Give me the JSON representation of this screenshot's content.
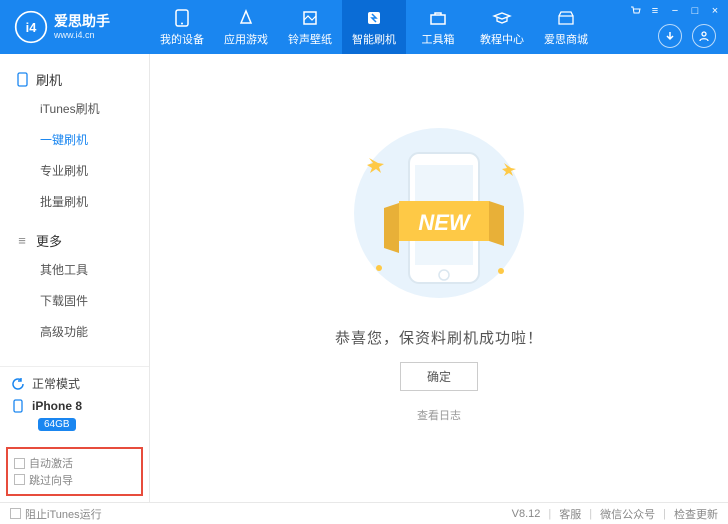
{
  "brand": {
    "name": "爱思助手",
    "sub": "www.i4.cn"
  },
  "nav": {
    "items": [
      {
        "label": "我的设备"
      },
      {
        "label": "应用游戏"
      },
      {
        "label": "铃声壁纸"
      },
      {
        "label": "智能刷机"
      },
      {
        "label": "工具箱"
      },
      {
        "label": "教程中心"
      },
      {
        "label": "爱思商城"
      }
    ],
    "activeIndex": 3
  },
  "sidebar": {
    "group1": {
      "title": "刷机",
      "items": [
        "iTunes刷机",
        "一键刷机",
        "专业刷机",
        "批量刷机"
      ],
      "selectedIndex": 1
    },
    "group2": {
      "title": "更多",
      "items": [
        "其他工具",
        "下载固件",
        "高级功能"
      ]
    },
    "mode": "正常模式",
    "device": {
      "name": "iPhone 8",
      "storage": "64GB"
    },
    "opts": {
      "autoActivate": "自动激活",
      "skipGuide": "跳过向导"
    }
  },
  "main": {
    "successText": "恭喜您，保资料刷机成功啦！",
    "okLabel": "确定",
    "logLabel": "查看日志",
    "newBadge": "NEW"
  },
  "footer": {
    "blockItunes": "阻止iTunes运行",
    "version": "V8.12",
    "support": "客服",
    "wechat": "微信公众号",
    "update": "检查更新"
  }
}
